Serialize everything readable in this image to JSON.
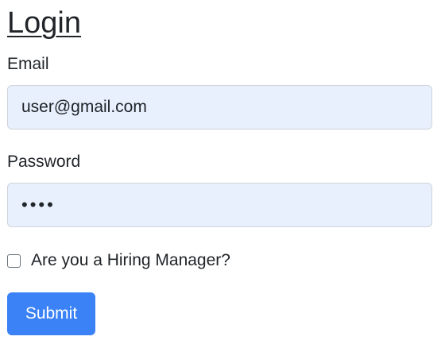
{
  "form": {
    "title": "Login",
    "email": {
      "label": "Email",
      "value": "user@gmail.com"
    },
    "password": {
      "label": "Password",
      "masked_value": "••••"
    },
    "hiring_manager": {
      "label": "Are you a Hiring Manager?",
      "checked": false
    },
    "submit_label": "Submit"
  },
  "colors": {
    "input_background": "#e8f0fe",
    "button_background": "#3b82f6",
    "button_text": "#ffffff"
  }
}
